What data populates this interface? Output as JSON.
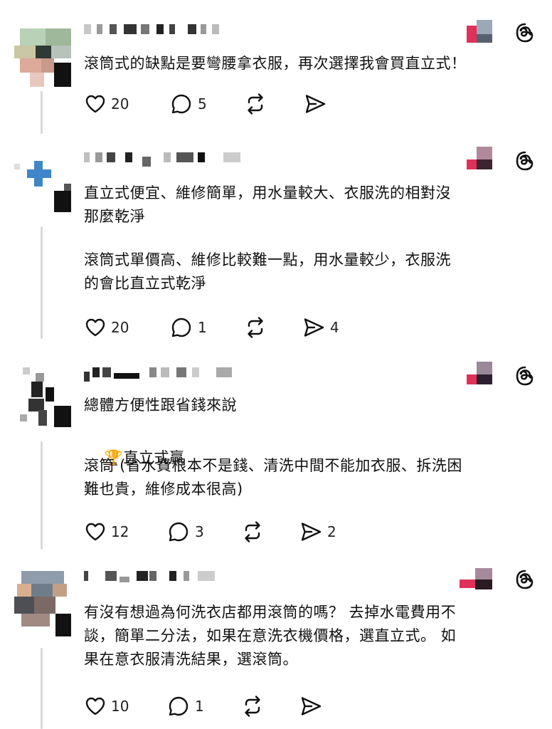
{
  "posts": [
    {
      "text": "滾筒式的缺點是要彎腰拿衣服，再次選擇我會買直立式！",
      "likes": "20",
      "replies": "5",
      "reposts": "",
      "shares": ""
    },
    {
      "text": "直立式便宜、維修簡單，用水量較大、衣服洗的相對沒\n那麼乾淨",
      "text2": "滾筒式單價高、維修比較難一點，用水量較少，衣服洗\n的會比直立式乾淨",
      "likes": "20",
      "replies": "1",
      "reposts": "",
      "shares": "4"
    },
    {
      "text": "總體方便性跟省錢來說",
      "trophy": "🏆",
      "text_b": "直立式贏",
      "text2": "滾筒 (省水費根本不是錢、清洗中間不能加衣服、拆洗困\n難也貴，維修成本很高)",
      "likes": "12",
      "replies": "3",
      "reposts": "",
      "shares": "2"
    },
    {
      "text": "有沒有想過為何洗衣店都用滾筒的嗎？ 去掉水電費用不\n談，簡單二分法，如果在意洗衣機價格，選直立式。 如\n果在意衣服清洗結果，選滾筒。",
      "likes": "10",
      "replies": "1",
      "reposts": "",
      "shares": ""
    }
  ],
  "icons": {
    "like": "heart-icon",
    "reply": "comment-bubble-icon",
    "repost": "repost-arrows-icon",
    "share": "paper-plane-icon",
    "brand": "threads-logo-icon"
  }
}
